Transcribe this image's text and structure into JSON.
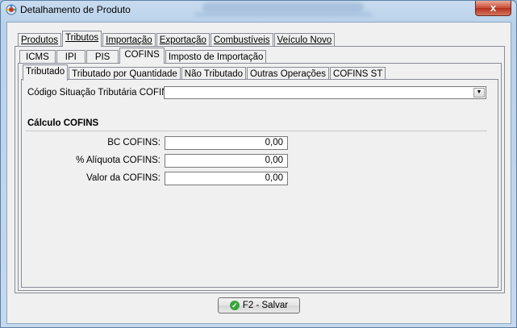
{
  "window": {
    "title": "Detalhamento de Produto",
    "close_label": "x"
  },
  "main_tabs": [
    {
      "label": "Produtos",
      "active": false
    },
    {
      "label": "Tributos",
      "active": true
    },
    {
      "label": "Importação",
      "active": false
    },
    {
      "label": "Exportação",
      "active": false
    },
    {
      "label": "Combustíveis",
      "active": false
    },
    {
      "label": "Veículo Novo",
      "active": false
    }
  ],
  "tax_tabs": [
    {
      "label": "ICMS",
      "active": false
    },
    {
      "label": "IPI",
      "active": false
    },
    {
      "label": "PIS",
      "active": false
    },
    {
      "label": "COFINS",
      "active": true
    },
    {
      "label": "Imposto de Importação",
      "active": false
    }
  ],
  "cofins_tabs": [
    {
      "label": "Tributado",
      "active": true
    },
    {
      "label": "Tributado por Quantidade",
      "active": false
    },
    {
      "label": "Não Tributado",
      "active": false
    },
    {
      "label": "Outras Operações",
      "active": false
    },
    {
      "label": "COFINS ST",
      "active": false
    }
  ],
  "form": {
    "cst_label": "Código Situação Tributária COFINS:",
    "cst_value": "",
    "section_title": "Cálculo COFINS",
    "bc_label": "BC COFINS:",
    "bc_value": "0,00",
    "aliquota_label": "% Alíquota COFINS:",
    "aliquota_value": "0,00",
    "valor_label": "Valor da COFINS:",
    "valor_value": "0,00"
  },
  "footer": {
    "save_label": "F2 - Salvar"
  },
  "colors": {
    "window_frame": "#b8d1ea",
    "close_button": "#c74a33",
    "ok_icon": "#3aa53a"
  }
}
